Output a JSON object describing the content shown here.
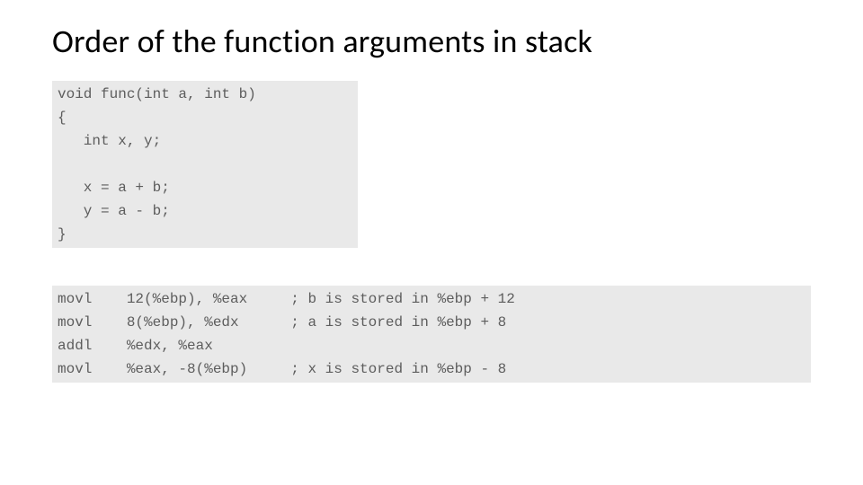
{
  "title": "Order of the function arguments in stack",
  "codeBlock1": "void func(int a, int b)\n{\n   int x, y;\n\n   x = a + b;\n   y = a - b;\n}",
  "codeBlock2": "movl    12(%ebp), %eax     ; b is stored in %ebp + 12\nmovl    8(%ebp), %edx      ; a is stored in %ebp + 8\naddl    %edx, %eax\nmovl    %eax, -8(%ebp)     ; x is stored in %ebp - 8"
}
